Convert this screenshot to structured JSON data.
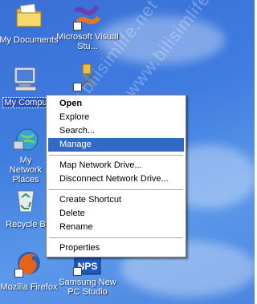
{
  "desktop": {
    "watermark": "www.bilisimlife.net",
    "icons": [
      {
        "label": "My Documents",
        "icon": "folder-documents-icon"
      },
      {
        "label": "Microsoft Visual Stu...",
        "icon": "visual-studio-icon"
      },
      {
        "label": "My Compu",
        "icon": "my-computer-icon"
      },
      {
        "label": "",
        "icon": "tools-shortcut-icon"
      },
      {
        "label": "My Network Places",
        "icon": "network-places-icon"
      },
      {
        "label": "Recycle B",
        "icon": "recycle-bin-icon"
      },
      {
        "label": "Mozilla Firefox",
        "icon": "firefox-icon"
      },
      {
        "label": "Samsung New PC Studio",
        "icon": "nps-icon"
      }
    ]
  },
  "context_menu": {
    "items": [
      {
        "label": "Open"
      },
      {
        "label": "Explore"
      },
      {
        "label": "Search..."
      },
      {
        "label": "Manage"
      },
      {
        "label": "Map Network Drive..."
      },
      {
        "label": "Disconnect Network Drive..."
      },
      {
        "label": "Create Shortcut"
      },
      {
        "label": "Delete"
      },
      {
        "label": "Rename"
      },
      {
        "label": "Properties"
      }
    ],
    "highlighted": "Manage",
    "highlight_color": "#316ac5"
  }
}
